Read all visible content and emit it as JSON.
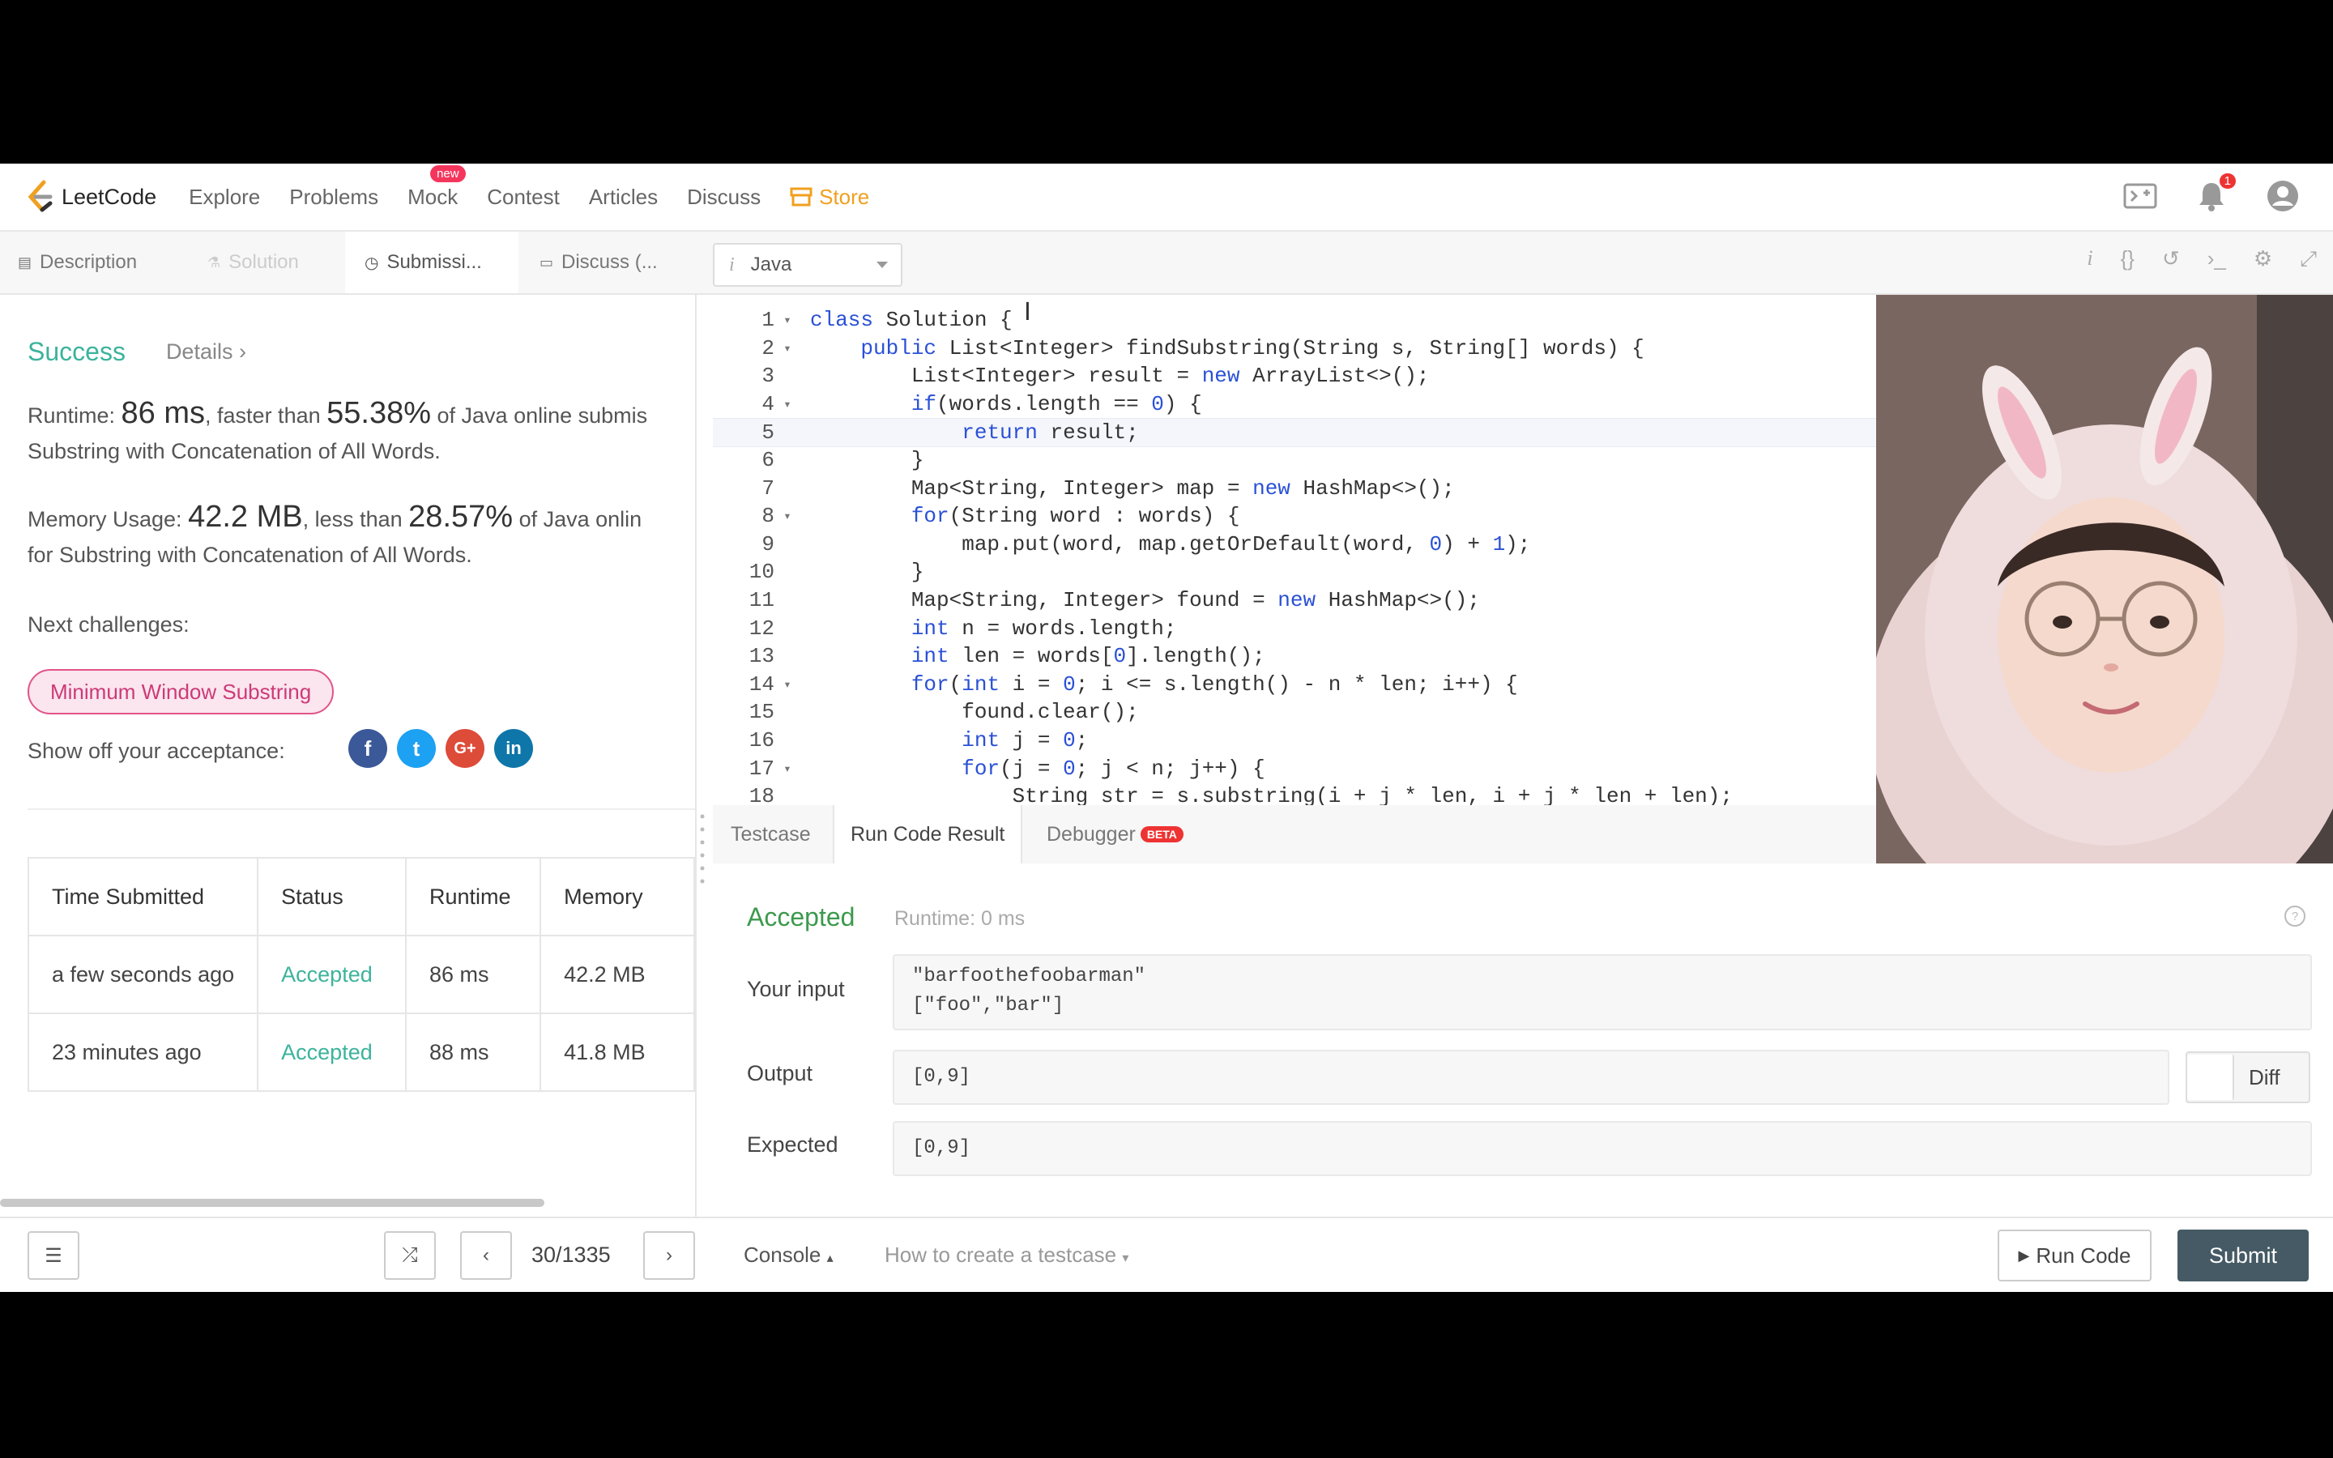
{
  "nav": {
    "logo": "LeetCode",
    "items": [
      "Explore",
      "Problems",
      "Mock",
      "Contest",
      "Articles",
      "Discuss"
    ],
    "mock_badge": "new",
    "store": "Store",
    "notification_count": "1"
  },
  "tabs": {
    "description": "Description",
    "solution": "Solution",
    "submissions": "Submissi...",
    "discuss": "Discuss (..."
  },
  "language": {
    "i": "i",
    "selected": "Java"
  },
  "left": {
    "success": "Success",
    "details": "Details",
    "runtime": {
      "label": "Runtime: ",
      "value": "86 ms",
      "mid": ", faster than ",
      "pct": "55.38%",
      "tail": " of Java online submis",
      "line2": "Substring with Concatenation of All Words."
    },
    "memory": {
      "label": "Memory Usage: ",
      "value": "42.2 MB",
      "mid": ", less than ",
      "pct": "28.57%",
      "tail": " of Java onlin",
      "line2": "for Substring with Concatenation of All Words."
    },
    "next_label": "Next challenges:",
    "next_challenge": "Minimum Window Substring",
    "share_label": "Show off your acceptance:",
    "share_icons": [
      "f",
      "t",
      "G+",
      "in"
    ],
    "table": {
      "headers": [
        "Time Submitted",
        "Status",
        "Runtime",
        "Memory"
      ],
      "rows": [
        [
          "a few seconds ago",
          "Accepted",
          "86 ms",
          "42.2 MB"
        ],
        [
          "23 minutes ago",
          "Accepted",
          "88 ms",
          "41.8 MB"
        ]
      ]
    }
  },
  "editor": {
    "lines": [
      {
        "n": "1",
        "fold": true,
        "code": "class Solution {"
      },
      {
        "n": "2",
        "fold": true,
        "code": "    public List<Integer> findSubstring(String s, String[] words) {"
      },
      {
        "n": "3",
        "fold": false,
        "code": "        List<Integer> result = new ArrayList<>();"
      },
      {
        "n": "4",
        "fold": true,
        "code": "        if(words.length == 0) {"
      },
      {
        "n": "5",
        "fold": false,
        "code": "            return result;"
      },
      {
        "n": "6",
        "fold": false,
        "code": "        }"
      },
      {
        "n": "7",
        "fold": false,
        "code": "        Map<String, Integer> map = new HashMap<>();"
      },
      {
        "n": "8",
        "fold": true,
        "code": "        for(String word : words) {"
      },
      {
        "n": "9",
        "fold": false,
        "code": "            map.put(word, map.getOrDefault(word, 0) + 1);"
      },
      {
        "n": "10",
        "fold": false,
        "code": "        }"
      },
      {
        "n": "11",
        "fold": false,
        "code": "        Map<String, Integer> found = new HashMap<>();"
      },
      {
        "n": "12",
        "fold": false,
        "code": "        int n = words.length;"
      },
      {
        "n": "13",
        "fold": false,
        "code": "        int len = words[0].length();"
      },
      {
        "n": "14",
        "fold": true,
        "code": "        for(int i = 0; i <= s.length() - n * len; i++) {"
      },
      {
        "n": "15",
        "fold": false,
        "code": "            found.clear();"
      },
      {
        "n": "16",
        "fold": false,
        "code": "            int j = 0;"
      },
      {
        "n": "17",
        "fold": true,
        "code": "            for(j = 0; j < n; j++) {"
      },
      {
        "n": "18",
        "fold": false,
        "code": "                String str = s.substring(i + j * len, i + j * len + len);"
      }
    ]
  },
  "result": {
    "tabs": [
      "Testcase",
      "Run Code Result",
      "Debugger"
    ],
    "beta": "BETA",
    "status": "Accepted",
    "runtime": "Runtime: 0 ms",
    "input_label": "Your input",
    "input_value": "\"barfoothefoobarman\"\n[\"foo\",\"bar\"]",
    "output_label": "Output",
    "output_value": "[0,9]",
    "expected_label": "Expected",
    "expected_value": "[0,9]",
    "diff": "Diff"
  },
  "bottom": {
    "pager": "30/1335",
    "console": "Console",
    "howto": "How to create a testcase",
    "run": "Run Code",
    "submit": "Submit"
  }
}
